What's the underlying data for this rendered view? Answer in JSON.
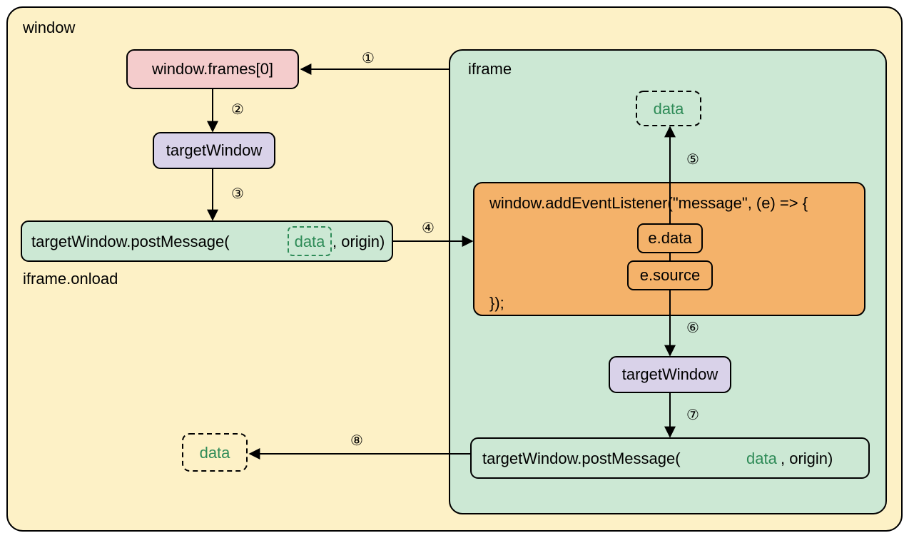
{
  "diagram": {
    "outer_label": "window",
    "iframe_label": "iframe",
    "window_frames": "window.frames[0]",
    "target_window": "targetWindow",
    "post_message_left_pre": "targetWindow.postMessage(",
    "post_message_left_data": "data",
    "post_message_left_post": ", origin)",
    "iframe_onload": "iframe.onload",
    "listener_open": "window.addEventListener(\"message\", (e) => {",
    "listener_edata": "e.data",
    "listener_esource": "e.source",
    "listener_close": "});",
    "data_top": "data",
    "target_window_right": "targetWindow",
    "post_message_right_pre": "targetWindow.postMessage(",
    "post_message_right_data": "data",
    "post_message_right_post": ", origin)",
    "data_bottom": "data",
    "steps": {
      "s1": "①",
      "s2": "②",
      "s3": "③",
      "s4": "④",
      "s5": "⑤",
      "s6": "⑥",
      "s7": "⑦",
      "s8": "⑧"
    }
  },
  "colors": {
    "outer_fill": "#fdf1c6",
    "iframe_fill": "#cce8d4",
    "pink_fill": "#f4cccc",
    "purple_fill": "#d9d2e9",
    "green_fill": "#cce8d4",
    "orange_fill": "#f4b26a",
    "stroke": "#000000",
    "data_stroke": "#000000",
    "data_stroke_green": "#2e8b57"
  }
}
